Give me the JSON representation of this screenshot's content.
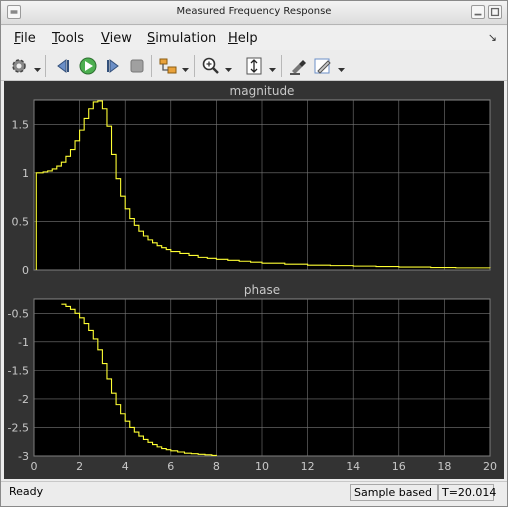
{
  "window": {
    "title": "Measured Frequency Response"
  },
  "menu": {
    "items": [
      {
        "key": "F",
        "rest": "ile"
      },
      {
        "key": "T",
        "rest": "ools"
      },
      {
        "key": "V",
        "rest": "iew"
      },
      {
        "key": "S",
        "rest": "imulation"
      },
      {
        "key": "H",
        "rest": "elp"
      }
    ],
    "dock_arrow": "↘"
  },
  "toolbar": {
    "icons": [
      "gear-icon",
      "step-back-icon",
      "run-icon",
      "step-forward-icon",
      "stop-icon",
      "signal-selector-icon",
      "zoom-in-icon",
      "scale-axes-icon",
      "highlight-icon",
      "style-icon"
    ]
  },
  "colors": {
    "background": "#333333",
    "axes": "#000000",
    "grid": "#777777",
    "signal": "#ffff33",
    "axis_text": "#c8c8c8"
  },
  "chart_data": [
    {
      "type": "line",
      "title": "magnitude",
      "xlabel": "",
      "ylabel": "",
      "xlim": [
        0,
        20
      ],
      "ylim": [
        0,
        1.75
      ],
      "grid": true,
      "x_ticks": [
        "0",
        "2",
        "4",
        "6",
        "8",
        "10",
        "12",
        "14",
        "16",
        "18",
        "20"
      ],
      "y_ticks": [
        "0",
        "0.5",
        "1",
        "1.5"
      ],
      "series": [
        {
          "style": "stairs",
          "x": [
            0.1,
            0.2,
            0.4,
            0.6,
            0.8,
            1.0,
            1.2,
            1.4,
            1.6,
            1.8,
            2.0,
            2.2,
            2.4,
            2.6,
            2.8,
            3.0,
            3.2,
            3.4,
            3.6,
            3.8,
            4.0,
            4.2,
            4.4,
            4.6,
            4.8,
            5.0,
            5.2,
            5.4,
            5.6,
            5.8,
            6.0,
            6.4,
            6.8,
            7.2,
            7.6,
            8.0,
            8.5,
            9.0,
            9.5,
            10.0,
            11.0,
            12.0,
            13.0,
            14.0,
            15.0,
            16.0,
            17.4,
            18.5,
            20.0
          ],
          "y": [
            1.0,
            1.0,
            1.01,
            1.02,
            1.04,
            1.07,
            1.11,
            1.17,
            1.24,
            1.33,
            1.44,
            1.56,
            1.66,
            1.73,
            1.74,
            1.66,
            1.48,
            1.19,
            0.94,
            0.76,
            0.63,
            0.53,
            0.46,
            0.4,
            0.35,
            0.31,
            0.28,
            0.25,
            0.23,
            0.21,
            0.19,
            0.17,
            0.15,
            0.13,
            0.12,
            0.11,
            0.1,
            0.09,
            0.08,
            0.07,
            0.06,
            0.05,
            0.045,
            0.04,
            0.035,
            0.03,
            0.025,
            0.022,
            0.02
          ]
        }
      ]
    },
    {
      "type": "line",
      "title": "phase",
      "xlabel": "",
      "ylabel": "",
      "xlim": [
        0,
        20
      ],
      "ylim": [
        -3,
        -0.25
      ],
      "grid": true,
      "x_ticks": [
        "0",
        "2",
        "4",
        "6",
        "8",
        "10",
        "12",
        "14",
        "16",
        "18",
        "20"
      ],
      "y_ticks": [
        "-0.5",
        "-1",
        "-1.5",
        "-2",
        "-2.5",
        "-3"
      ],
      "series": [
        {
          "style": "stairs",
          "x": [
            1.2,
            1.4,
            1.6,
            1.8,
            2.0,
            2.2,
            2.4,
            2.6,
            2.8,
            3.0,
            3.2,
            3.4,
            3.6,
            3.8,
            4.0,
            4.2,
            4.4,
            4.6,
            4.8,
            5.0,
            5.2,
            5.4,
            5.6,
            5.8,
            6.0,
            6.3,
            6.6,
            6.9,
            7.2,
            7.5,
            7.8,
            8.0
          ],
          "y": [
            -0.34,
            -0.38,
            -0.43,
            -0.5,
            -0.58,
            -0.68,
            -0.8,
            -0.95,
            -1.14,
            -1.38,
            -1.65,
            -1.9,
            -2.1,
            -2.26,
            -2.39,
            -2.5,
            -2.58,
            -2.65,
            -2.71,
            -2.76,
            -2.8,
            -2.84,
            -2.87,
            -2.89,
            -2.91,
            -2.93,
            -2.95,
            -2.96,
            -2.97,
            -2.98,
            -2.99,
            -3.0
          ]
        }
      ]
    }
  ],
  "status": {
    "ready": "Ready",
    "mode": "Sample based",
    "time": "T=20.014"
  }
}
